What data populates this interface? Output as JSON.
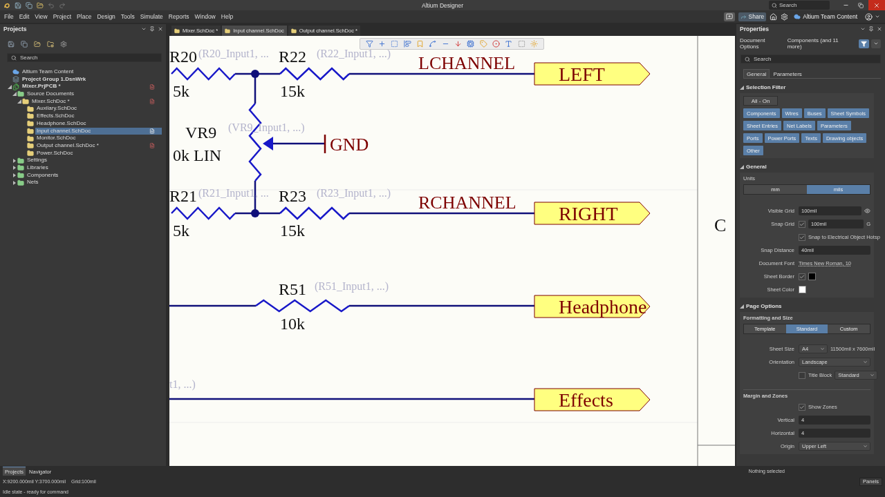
{
  "title_bar": {
    "title": "Altium Designer",
    "search_placeholder": "Search"
  },
  "menu": [
    "File",
    "Edit",
    "View",
    "Project",
    "Place",
    "Design",
    "Tools",
    "Simulate",
    "Reports",
    "Window",
    "Help"
  ],
  "header_actions": {
    "share": "Share",
    "workspace": "Altium Team Content"
  },
  "projects_panel": {
    "title": "Projects",
    "search_placeholder": "Search",
    "tree": [
      {
        "label": "Altium Team Content",
        "kind": "cloud",
        "selected": false
      },
      {
        "label": "Project Group 1.DsnWrk",
        "kind": "workspace",
        "selected": false,
        "children": [
          {
            "label": "Mixer.PrjPCB *",
            "kind": "project",
            "expanded": true,
            "selected": false,
            "modified": true,
            "children": [
              {
                "label": "Source Documents",
                "kind": "folder",
                "expanded": true,
                "selected": false,
                "children": [
                  {
                    "label": "Mixer.SchDoc *",
                    "kind": "sheet",
                    "expanded": true,
                    "selected": false,
                    "modified": true,
                    "children": [
                      {
                        "label": "Auxilary.SchDoc",
                        "kind": "sheet",
                        "selected": false
                      },
                      {
                        "label": "Effects.SchDoc",
                        "kind": "sheet",
                        "selected": false
                      },
                      {
                        "label": "Headphone.SchDoc",
                        "kind": "sheet",
                        "selected": false
                      },
                      {
                        "label": "Input channel.SchDoc",
                        "kind": "sheet",
                        "selected": true,
                        "modified": false
                      },
                      {
                        "label": "Monitor.SchDoc",
                        "kind": "sheet",
                        "selected": false
                      },
                      {
                        "label": "Output channel.SchDoc *",
                        "kind": "sheet",
                        "selected": false,
                        "modified": true
                      },
                      {
                        "label": "Power.SchDoc",
                        "kind": "sheet",
                        "selected": false
                      }
                    ]
                  }
                ]
              },
              {
                "label": "Settings",
                "kind": "folder",
                "expanded": false,
                "selected": false
              },
              {
                "label": "Libraries",
                "kind": "folder",
                "expanded": false,
                "selected": false
              },
              {
                "label": "Components",
                "kind": "folder",
                "expanded": false,
                "selected": false
              },
              {
                "label": "Nets",
                "kind": "folder",
                "expanded": false,
                "selected": false
              }
            ]
          }
        ]
      }
    ]
  },
  "doc_tabs": [
    {
      "label": "Mixer.SchDoc *",
      "selected": false
    },
    {
      "label": "Input channel.SchDoc",
      "selected": true
    },
    {
      "label": "Output channel.SchDoc *",
      "selected": false
    }
  ],
  "schematic": {
    "components": [
      {
        "kind": "resistor",
        "designator": "R20",
        "parameters": "(R20_Input1, ...",
        "value": "5k"
      },
      {
        "kind": "resistor",
        "designator": "R22",
        "parameters": "(R22_Input1, ...)",
        "value": "15k"
      },
      {
        "kind": "potentiometer",
        "designator": "VR9",
        "parameters": "(VR9_Input1, ...)",
        "value": "0k LIN"
      },
      {
        "kind": "resistor",
        "designator": "R21",
        "parameters": "(R21_Input1, ...",
        "value": "5k"
      },
      {
        "kind": "resistor",
        "designator": "R23",
        "parameters": "(R23_Input1, ...)",
        "value": "15k"
      },
      {
        "kind": "resistor",
        "designator": "R51",
        "parameters": "(R51_Input1, ...)",
        "value": "10k"
      }
    ],
    "power_ports": [
      {
        "label": "GND"
      }
    ],
    "net_labels": [
      "LCHANNEL",
      "RCHANNEL"
    ],
    "ports": [
      "LEFT",
      "RIGHT",
      "Headphone",
      "Effects"
    ],
    "fragment": "t1, ...)",
    "zone": "C"
  },
  "properties_panel": {
    "title": "Properties",
    "mode": "Document Options",
    "filter_summary": "Components (and 11 more)",
    "search_placeholder": "Search",
    "tabs": [
      {
        "label": "General",
        "selected": true
      },
      {
        "label": "Parameters",
        "selected": false
      }
    ],
    "selection_filter": {
      "title": "Selection Filter",
      "all_button": "All - On",
      "filters": [
        {
          "label": "Components",
          "on": true
        },
        {
          "label": "Wires",
          "on": true
        },
        {
          "label": "Buses",
          "on": true
        },
        {
          "label": "Sheet Symbols",
          "on": true
        },
        {
          "label": "Sheet Entries",
          "on": true
        },
        {
          "label": "Net Labels",
          "on": true
        },
        {
          "label": "Parameters",
          "on": true
        },
        {
          "label": "Ports",
          "on": true
        },
        {
          "label": "Power Ports",
          "on": true
        },
        {
          "label": "Texts",
          "on": true
        },
        {
          "label": "Drawing objects",
          "on": true
        },
        {
          "label": "Other",
          "on": true
        }
      ]
    },
    "general": {
      "title": "General",
      "units_label": "Units",
      "units": [
        {
          "label": "mm",
          "selected": false
        },
        {
          "label": "mils",
          "selected": true
        }
      ],
      "visible_grid": {
        "label": "Visible Grid",
        "value": "100mil"
      },
      "snap_grid": {
        "label": "Snap Grid",
        "checked": true,
        "value": "100mil",
        "shortcut": "G"
      },
      "snap_hotspot": {
        "label": "Snap to Electrical Object Hotsp",
        "checked": true
      },
      "snap_distance": {
        "label": "Snap Distance",
        "value": "40mil"
      },
      "document_font": {
        "label": "Document Font",
        "value": "Times New Roman, 10"
      },
      "sheet_border": {
        "label": "Sheet Border",
        "checked": true,
        "color": "#000000"
      },
      "sheet_color": {
        "label": "Sheet Color",
        "color": "#ffffff"
      }
    },
    "page_options": {
      "title": "Page Options",
      "formatting_title": "Formatting and Size",
      "modes": [
        {
          "label": "Template",
          "selected": false
        },
        {
          "label": "Standard",
          "selected": true
        },
        {
          "label": "Custom",
          "selected": false
        }
      ],
      "sheet_size": {
        "label": "Sheet Size",
        "value": "A4",
        "dimensions": "11500mil x 7600mil"
      },
      "orientation": {
        "label": "Orientation",
        "value": "Landscape"
      },
      "title_block": {
        "label": "Title Block",
        "checked": false,
        "value": "Standard"
      },
      "margin_title": "Margin and Zones",
      "show_zones": {
        "label": "Show Zones",
        "checked": true
      },
      "vertical": {
        "label": "Vertical",
        "value": "4"
      },
      "horizontal": {
        "label": "Horizontal",
        "value": "4"
      },
      "origin": {
        "label": "Origin",
        "value": "Upper Left"
      }
    }
  },
  "bottom_tabs": [
    {
      "label": "Projects",
      "selected": true
    },
    {
      "label": "Navigator",
      "selected": false
    }
  ],
  "status": {
    "coords": "X:9200.000mil Y:3700.000mil",
    "grid": "Grid:100mil",
    "message": "Idle state - ready for command",
    "selection": "Nothing selected",
    "panels_button": "Panels"
  }
}
